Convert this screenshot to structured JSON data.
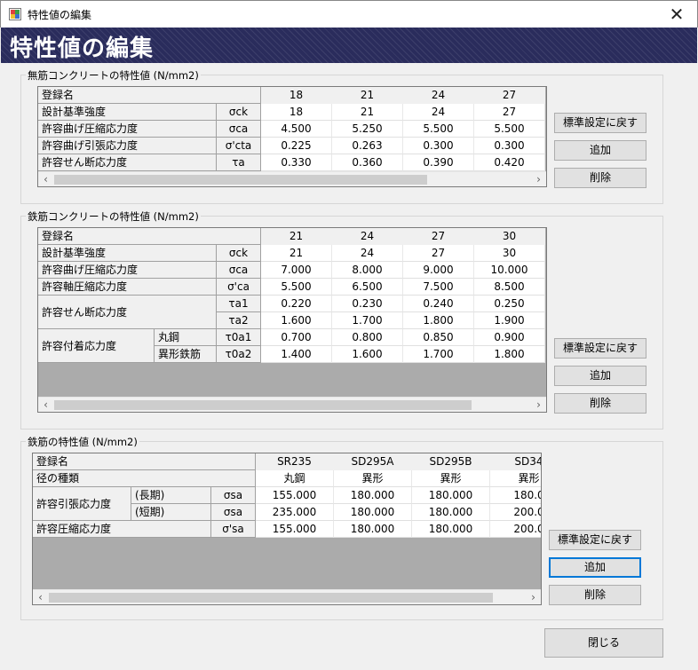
{
  "window": {
    "title": "特性値の編集",
    "close_glyph": "✕"
  },
  "banner": {
    "title": "特性値の編集"
  },
  "plain_concrete": {
    "legend": "無筋コンクリートの特性値 (N/mm2)",
    "header_label": "登録名",
    "columns": [
      "18",
      "21",
      "24",
      "27"
    ],
    "rows": [
      {
        "label": "設計基準強度",
        "symbol": "σck",
        "values": [
          "18",
          "21",
          "24",
          "27"
        ]
      },
      {
        "label": "許容曲げ圧縮応力度",
        "symbol": "σca",
        "values": [
          "4.500",
          "5.250",
          "5.500",
          "5.500"
        ]
      },
      {
        "label": "許容曲げ引張応力度",
        "symbol": "σ'cta",
        "values": [
          "0.225",
          "0.263",
          "0.300",
          "0.300"
        ]
      },
      {
        "label": "許容せん断応力度",
        "symbol": "τa",
        "values": [
          "0.330",
          "0.360",
          "0.390",
          "0.420"
        ]
      }
    ],
    "buttons": {
      "reset": "標準設定に戻す",
      "add": "追加",
      "delete": "削除"
    }
  },
  "rc_concrete": {
    "legend": "鉄筋コンクリートの特性値 (N/mm2)",
    "header_label": "登録名",
    "columns": [
      "21",
      "24",
      "27",
      "30"
    ],
    "rows": [
      {
        "label": "設計基準強度",
        "symbol": "σck",
        "values": [
          "21",
          "24",
          "27",
          "30"
        ]
      },
      {
        "label": "許容曲げ圧縮応力度",
        "symbol": "σca",
        "values": [
          "7.000",
          "8.000",
          "9.000",
          "10.000"
        ]
      },
      {
        "label": "許容軸圧縮応力度",
        "symbol": "σ'ca",
        "values": [
          "5.500",
          "6.500",
          "7.500",
          "8.500"
        ]
      }
    ],
    "shear": {
      "label": "許容せん断応力度",
      "rows": [
        {
          "symbol": "τa1",
          "values": [
            "0.220",
            "0.230",
            "0.240",
            "0.250"
          ]
        },
        {
          "symbol": "τa2",
          "values": [
            "1.600",
            "1.700",
            "1.800",
            "1.900"
          ]
        }
      ]
    },
    "bond": {
      "label": "許容付着応力度",
      "rows": [
        {
          "sub": "丸鋼",
          "symbol": "τ0a1",
          "values": [
            "0.700",
            "0.800",
            "0.850",
            "0.900"
          ]
        },
        {
          "sub": "異形鉄筋",
          "symbol": "τ0a2",
          "values": [
            "1.400",
            "1.600",
            "1.700",
            "1.800"
          ]
        }
      ]
    },
    "buttons": {
      "reset": "標準設定に戻す",
      "add": "追加",
      "delete": "削除"
    }
  },
  "rebar": {
    "legend": "鉄筋の特性値 (N/mm2)",
    "header_label": "登録名",
    "columns": [
      "SR235",
      "SD295A",
      "SD295B",
      "SD34"
    ],
    "type_row": {
      "label": "径の種類",
      "values": [
        "丸鋼",
        "異形",
        "異形",
        "異形"
      ]
    },
    "tension": {
      "label": "許容引張応力度",
      "rows": [
        {
          "sub": "(長期)",
          "symbol": "σsa",
          "values": [
            "155.000",
            "180.000",
            "180.000",
            "180.0"
          ]
        },
        {
          "sub": "(短期)",
          "symbol": "σsa",
          "values": [
            "235.000",
            "180.000",
            "180.000",
            "200.0"
          ]
        }
      ]
    },
    "compression": {
      "label": "許容圧縮応力度",
      "symbol": "σ'sa",
      "values": [
        "155.000",
        "180.000",
        "180.000",
        "200.0"
      ]
    },
    "buttons": {
      "reset": "標準設定に戻す",
      "add": "追加",
      "delete": "削除"
    }
  },
  "footer": {
    "close": "閉じる"
  }
}
